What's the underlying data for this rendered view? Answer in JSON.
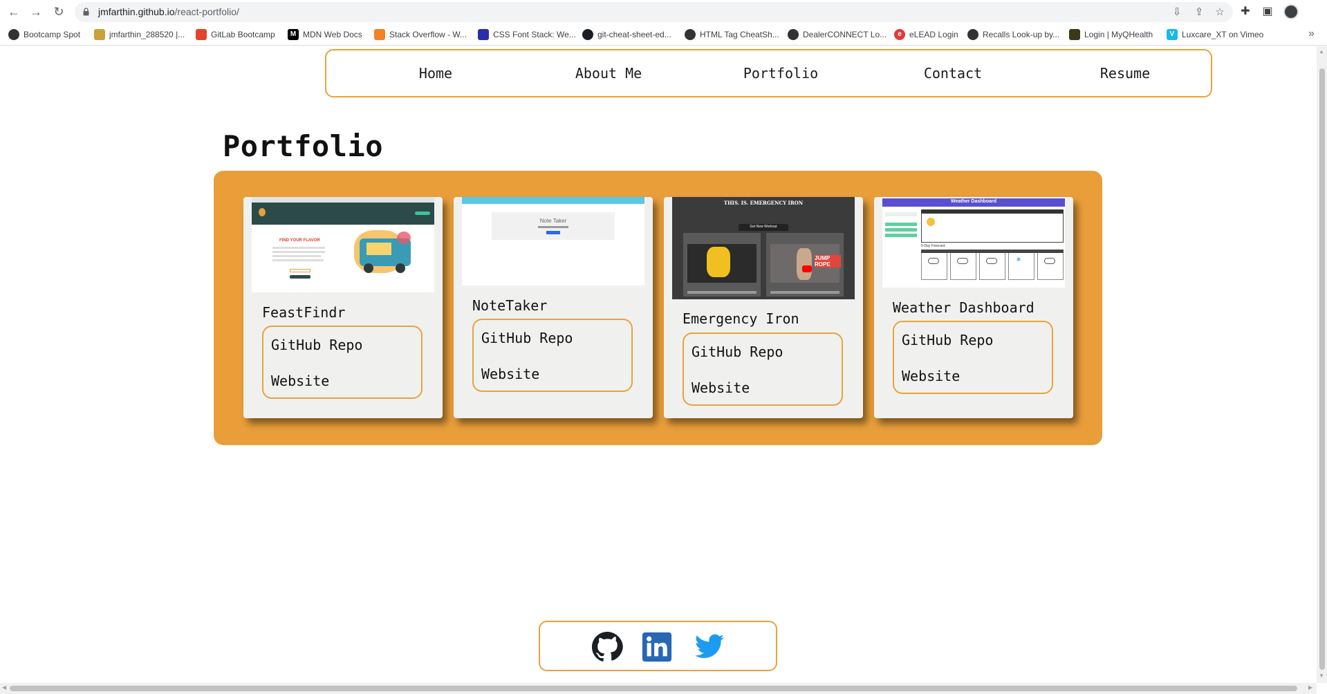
{
  "browser": {
    "url_domain": "jmfarthin.github.io",
    "url_path": "/react-portfolio/",
    "bookmarks": [
      {
        "label": "Bootcamp Spot",
        "color": "#333333",
        "icon": "circle-icon"
      },
      {
        "label": "jmfarthin_288520 |...",
        "color": "#c8a23a",
        "icon": "badge-icon"
      },
      {
        "label": "GitLab Bootcamp",
        "color": "#e2432a",
        "icon": "gitlab-icon"
      },
      {
        "label": "MDN Web Docs",
        "color": "#000000",
        "icon": "mdn-icon"
      },
      {
        "label": "Stack Overflow - W...",
        "color": "#f48024",
        "icon": "stackoverflow-icon"
      },
      {
        "label": "CSS Font Stack: We...",
        "color": "#2a2fa8",
        "icon": "cssfont-icon"
      },
      {
        "label": "git-cheat-sheet-ed...",
        "color": "#1b1f23",
        "icon": "github-icon"
      },
      {
        "label": "HTML Tag CheatSh...",
        "color": "#333333",
        "icon": "globe-icon"
      },
      {
        "label": "DealerCONNECT Lo...",
        "color": "#333333",
        "icon": "globe-icon"
      },
      {
        "label": "eLEAD Login",
        "color": "#e03a3a",
        "icon": "elead-icon"
      },
      {
        "label": "Recalls Look-up by...",
        "color": "#333333",
        "icon": "globe-icon"
      },
      {
        "label": "Login | MyQHealth",
        "color": "#3a3a1a",
        "icon": "myq-icon"
      },
      {
        "label": "Luxcare_XT on Vimeo",
        "color": "#1ab7ea",
        "icon": "vimeo-icon"
      }
    ]
  },
  "nav": {
    "items": [
      "Home",
      "About Me",
      "Portfolio",
      "Contact",
      "Resume"
    ]
  },
  "page": {
    "title": "Portfolio"
  },
  "projects": [
    {
      "title": "FeastFindr",
      "repo_label": "GitHub Repo",
      "site_label": "Website",
      "thumb": {
        "header": "FIND YOUR FLAVOR",
        "accent": "#e33b2e"
      }
    },
    {
      "title": "NoteTaker",
      "repo_label": "GitHub Repo",
      "site_label": "Website",
      "thumb": {
        "header": "Note Taker"
      }
    },
    {
      "title": "Emergency Iron",
      "repo_label": "GitHub Repo",
      "site_label": "Website",
      "thumb": {
        "header": "THIS. IS. EMERGENCY IRON",
        "sub": "Get New Workout",
        "badge": "JUMP ROPE"
      }
    },
    {
      "title": "Weather Dashboard",
      "repo_label": "GitHub Repo",
      "site_label": "Website",
      "thumb": {
        "header": "Weather Dashboard",
        "sub": "5-Day Forecast:"
      }
    }
  ],
  "footer": {
    "icons": [
      "github-icon",
      "linkedin-icon",
      "twitter-icon"
    ],
    "colors": {
      "github": "#1b1f23",
      "linkedin": "#2867b2",
      "twitter": "#1d9bf0"
    }
  },
  "colors": {
    "accent": "#e9a23b",
    "panel": "#e99e3a",
    "card": "#f0f1ef"
  }
}
